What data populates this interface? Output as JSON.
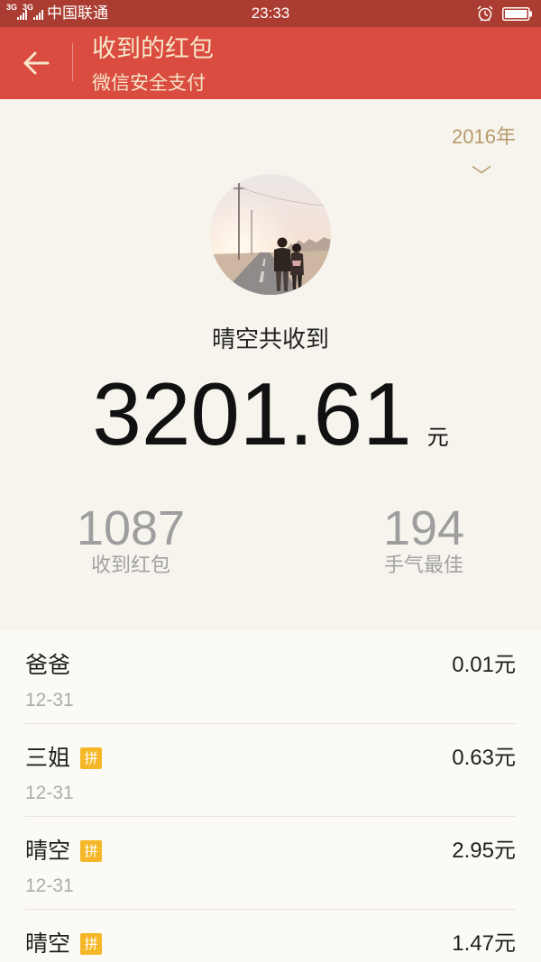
{
  "status_bar": {
    "network_1": "3G",
    "network_2": "3G",
    "carrier": "中国联通",
    "time": "23:33"
  },
  "header": {
    "title": "收到的红包",
    "subtitle": "微信安全支付"
  },
  "year_selector": {
    "label": "2016年"
  },
  "summary": {
    "receiver_line": "晴空共收到",
    "total_amount": "3201.61",
    "currency": "元",
    "stats": [
      {
        "value": "1087",
        "label": "收到红包"
      },
      {
        "value": "194",
        "label": "手气最佳"
      }
    ]
  },
  "records": [
    {
      "name": "爸爸",
      "date": "12-31",
      "amount": "0.01元"
    },
    {
      "name": "三姐",
      "badge": "拼",
      "date": "12-31",
      "amount": "0.63元"
    },
    {
      "name": "晴空",
      "badge": "拼",
      "date": "12-31",
      "amount": "2.95元"
    },
    {
      "name": "晴空",
      "badge": "拼",
      "amount": "1.47元"
    }
  ],
  "icons": {
    "back": "arrow-left-icon",
    "year_dropdown": "chevron-down-icon",
    "alarm": "alarm-clock-icon",
    "battery": "battery-icon",
    "signal": "signal-icon"
  },
  "colors": {
    "status_bar_bg": "#ab3c31",
    "header_bg": "#d94c3f",
    "header_text": "#f8e6cb",
    "page_bg": "#f7f4ee",
    "list_bg": "#fcfaf6",
    "year_accent": "#b89b6c",
    "badge_bg": "#f5b727"
  }
}
